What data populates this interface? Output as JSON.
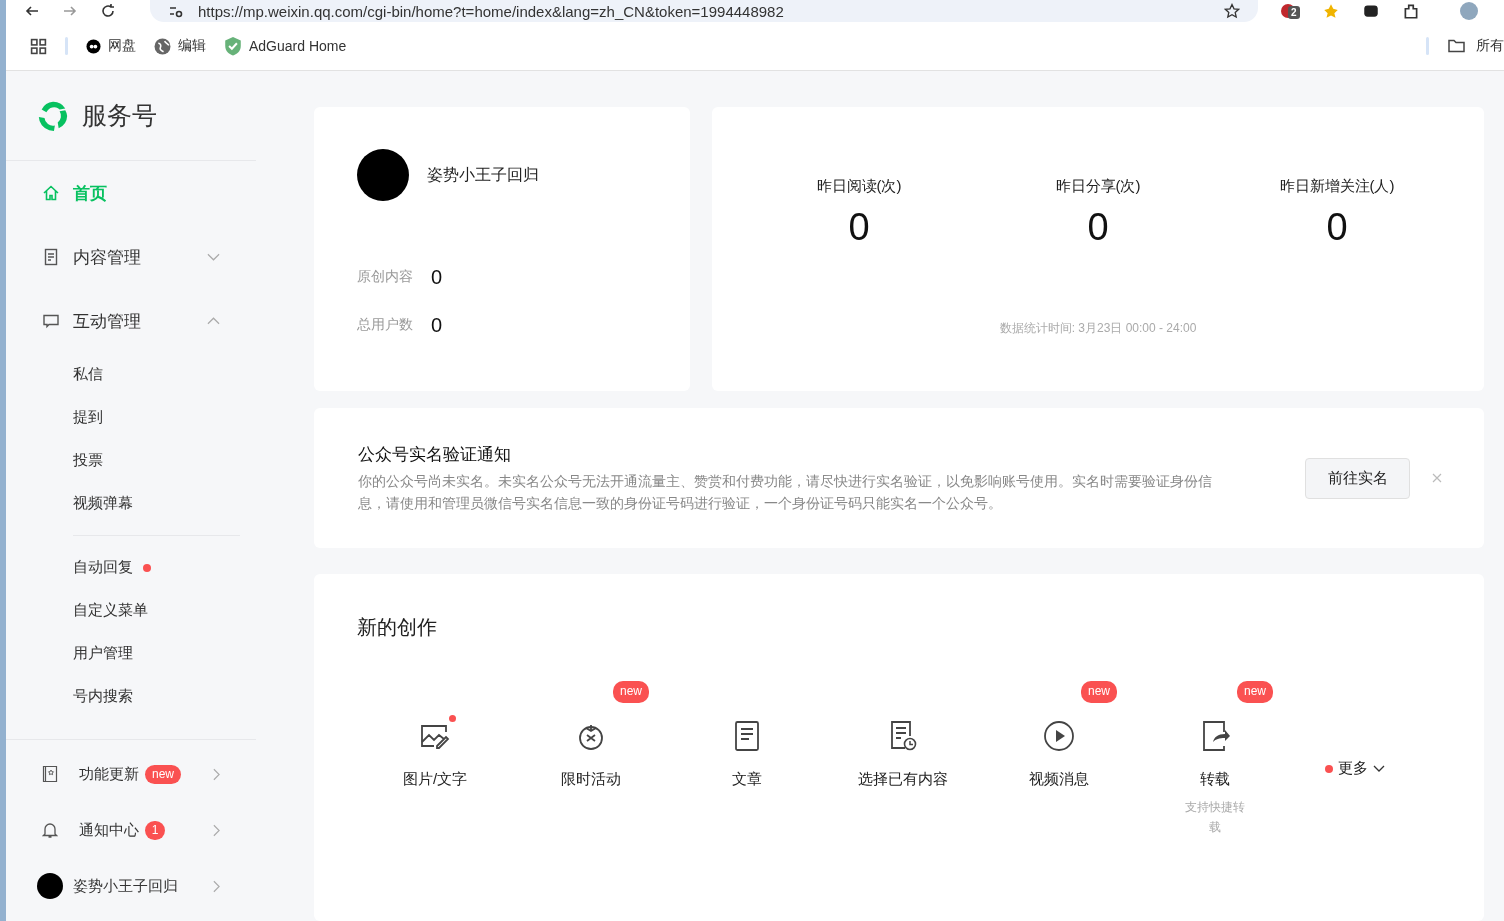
{
  "browser": {
    "url": "https://mp.weixin.qq.com/cgi-bin/home?t=home/index&lang=zh_CN&token=1994448982",
    "extension_badge": "2",
    "bookmarks": [
      {
        "label": "网盘"
      },
      {
        "label": "编辑"
      },
      {
        "label": "AdGuard Home"
      }
    ],
    "bookmarks_folder": "所有"
  },
  "sidebar": {
    "logo_text": "服务号",
    "menus": [
      {
        "label": "首页",
        "selected": true
      },
      {
        "label": "内容管理",
        "selected": false,
        "expanded": false
      },
      {
        "label": "互动管理",
        "selected": false,
        "expanded": true,
        "sections": [
          {
            "children": [
              {
                "label": "私信",
                "dot": false
              },
              {
                "label": "提到",
                "dot": false
              },
              {
                "label": "投票",
                "dot": false
              },
              {
                "label": "视频弹幕",
                "dot": false
              }
            ]
          },
          {
            "children": [
              {
                "label": "自动回复",
                "dot": true
              },
              {
                "label": "自定义菜单",
                "dot": false
              },
              {
                "label": "用户管理",
                "dot": false
              },
              {
                "label": "号内搜索",
                "dot": false
              }
            ]
          }
        ]
      }
    ],
    "footer": [
      {
        "kind": "icon",
        "label": "功能更新",
        "badge": "new"
      },
      {
        "kind": "icon",
        "label": "通知中心",
        "badge": "1"
      },
      {
        "kind": "avatar",
        "label": "姿势小王子回归"
      }
    ]
  },
  "profile": {
    "name": "姿势小王子回归",
    "stats": [
      {
        "label": "原创内容",
        "value": "0"
      },
      {
        "label": "总用户数",
        "value": "0"
      }
    ]
  },
  "yesterday": {
    "stats": [
      {
        "label": "昨日阅读(次)",
        "value": "0"
      },
      {
        "label": "昨日分享(次)",
        "value": "0"
      },
      {
        "label": "昨日新增关注(人)",
        "value": "0"
      }
    ],
    "note": "数据统计时间: 3月23日 00:00 - 24:00"
  },
  "notice": {
    "title": "公众号实名验证通知",
    "text": "你的公众号尚未实名。未实名公众号无法开通流量主、赞赏和付费功能，请尽快进行实名验证，以免影响账号使用。实名时需要验证身份信息，请使用和管理员微信号实名信息一致的身份证号码进行验证，一个身份证号码只能实名一个公众号。",
    "button": "前往实名"
  },
  "creation": {
    "title": "新的创作",
    "items": [
      {
        "label": "图片/文字",
        "dot": true
      },
      {
        "label": "限时活动",
        "badge": "new",
        "dot": false
      },
      {
        "label": "文章",
        "dot": false
      },
      {
        "label": "选择已有内容",
        "dot": false
      },
      {
        "label": "视频消息",
        "badge": "new",
        "dot": false
      },
      {
        "label": "转载",
        "badge": "new",
        "dot": false,
        "subtitle": "支持快捷转载"
      }
    ],
    "more": {
      "label": "更多",
      "dot": true
    }
  }
}
